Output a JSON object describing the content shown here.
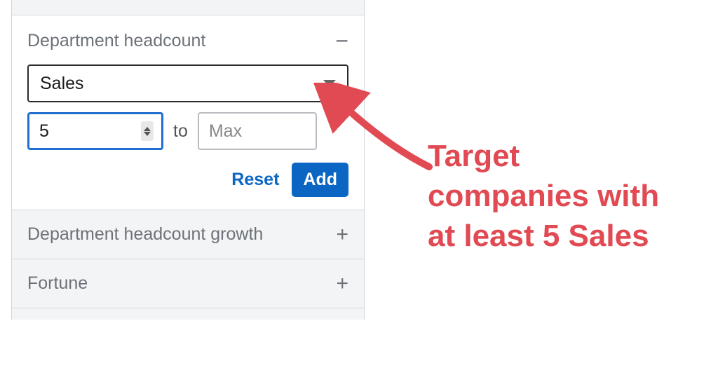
{
  "filter": {
    "expanded": {
      "title": "Department headcount",
      "toggle_icon": "minus",
      "select_value": "Sales",
      "min_value": "5",
      "range_connector": "to",
      "max_placeholder": "Max",
      "reset_label": "Reset",
      "add_label": "Add"
    },
    "collapsed": [
      {
        "title": "Department headcount growth",
        "icon": "plus"
      },
      {
        "title": "Fortune",
        "icon": "plus"
      }
    ]
  },
  "annotation": {
    "text": "Target companies with at least 5 Sales",
    "color": "#e14a53"
  }
}
